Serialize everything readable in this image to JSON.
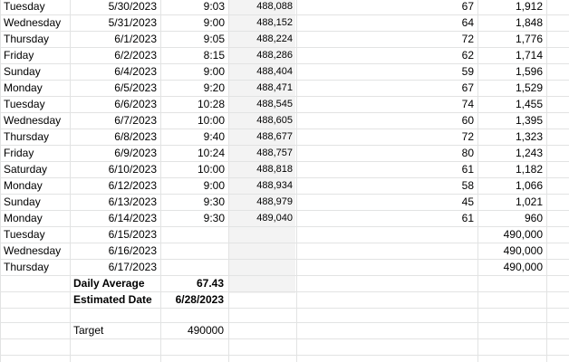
{
  "rows": [
    {
      "day": "Tuesday",
      "date": "5/30/2023",
      "time": "9:03",
      "reading": "488,088",
      "diff": "67",
      "remaining": "1,912"
    },
    {
      "day": "Wednesday",
      "date": "5/31/2023",
      "time": "9:00",
      "reading": "488,152",
      "diff": "64",
      "remaining": "1,848"
    },
    {
      "day": "Thursday",
      "date": "6/1/2023",
      "time": "9:05",
      "reading": "488,224",
      "diff": "72",
      "remaining": "1,776"
    },
    {
      "day": "Friday",
      "date": "6/2/2023",
      "time": "8:15",
      "reading": "488,286",
      "diff": "62",
      "remaining": "1,714"
    },
    {
      "day": "Sunday",
      "date": "6/4/2023",
      "time": "9:00",
      "reading": "488,404",
      "diff": "59",
      "remaining": "1,596"
    },
    {
      "day": "Monday",
      "date": "6/5/2023",
      "time": "9:20",
      "reading": "488,471",
      "diff": "67",
      "remaining": "1,529"
    },
    {
      "day": "Tuesday",
      "date": "6/6/2023",
      "time": "10:28",
      "reading": "488,545",
      "diff": "74",
      "remaining": "1,455"
    },
    {
      "day": "Wednesday",
      "date": "6/7/2023",
      "time": "10:00",
      "reading": "488,605",
      "diff": "60",
      "remaining": "1,395"
    },
    {
      "day": "Thursday",
      "date": "6/8/2023",
      "time": "9:40",
      "reading": "488,677",
      "diff": "72",
      "remaining": "1,323"
    },
    {
      "day": "Friday",
      "date": "6/9/2023",
      "time": "10:24",
      "reading": "488,757",
      "diff": "80",
      "remaining": "1,243"
    },
    {
      "day": "Saturday",
      "date": "6/10/2023",
      "time": "10:00",
      "reading": "488,818",
      "diff": "61",
      "remaining": "1,182"
    },
    {
      "day": "Monday",
      "date": "6/12/2023",
      "time": "9:00",
      "reading": "488,934",
      "diff": "58",
      "remaining": "1,066"
    },
    {
      "day": "Sunday",
      "date": "6/13/2023",
      "time": "9:30",
      "reading": "488,979",
      "diff": "45",
      "remaining": "1,021"
    },
    {
      "day": "Monday",
      "date": "6/14/2023",
      "time": "9:30",
      "reading": "489,040",
      "diff": "61",
      "remaining": "960"
    },
    {
      "day": "Tuesday",
      "date": "6/15/2023",
      "time": "",
      "reading": "",
      "diff": "",
      "remaining": "490,000"
    },
    {
      "day": "Wednesday",
      "date": "6/16/2023",
      "time": "",
      "reading": "",
      "diff": "",
      "remaining": "490,000"
    },
    {
      "day": "Thursday",
      "date": "6/17/2023",
      "time": "",
      "reading": "",
      "diff": "",
      "remaining": "490,000"
    }
  ],
  "summary": {
    "daily_average_label": "Daily Average",
    "daily_average_value": "67.43",
    "estimated_date_label": "Estimated Date",
    "estimated_date_value": "6/28/2023",
    "target_label": "Target",
    "target_value": "490000"
  },
  "colors": {
    "gridline": "#e2e3e3",
    "shaded_column": "#f3f3f3",
    "text": "#000000"
  }
}
